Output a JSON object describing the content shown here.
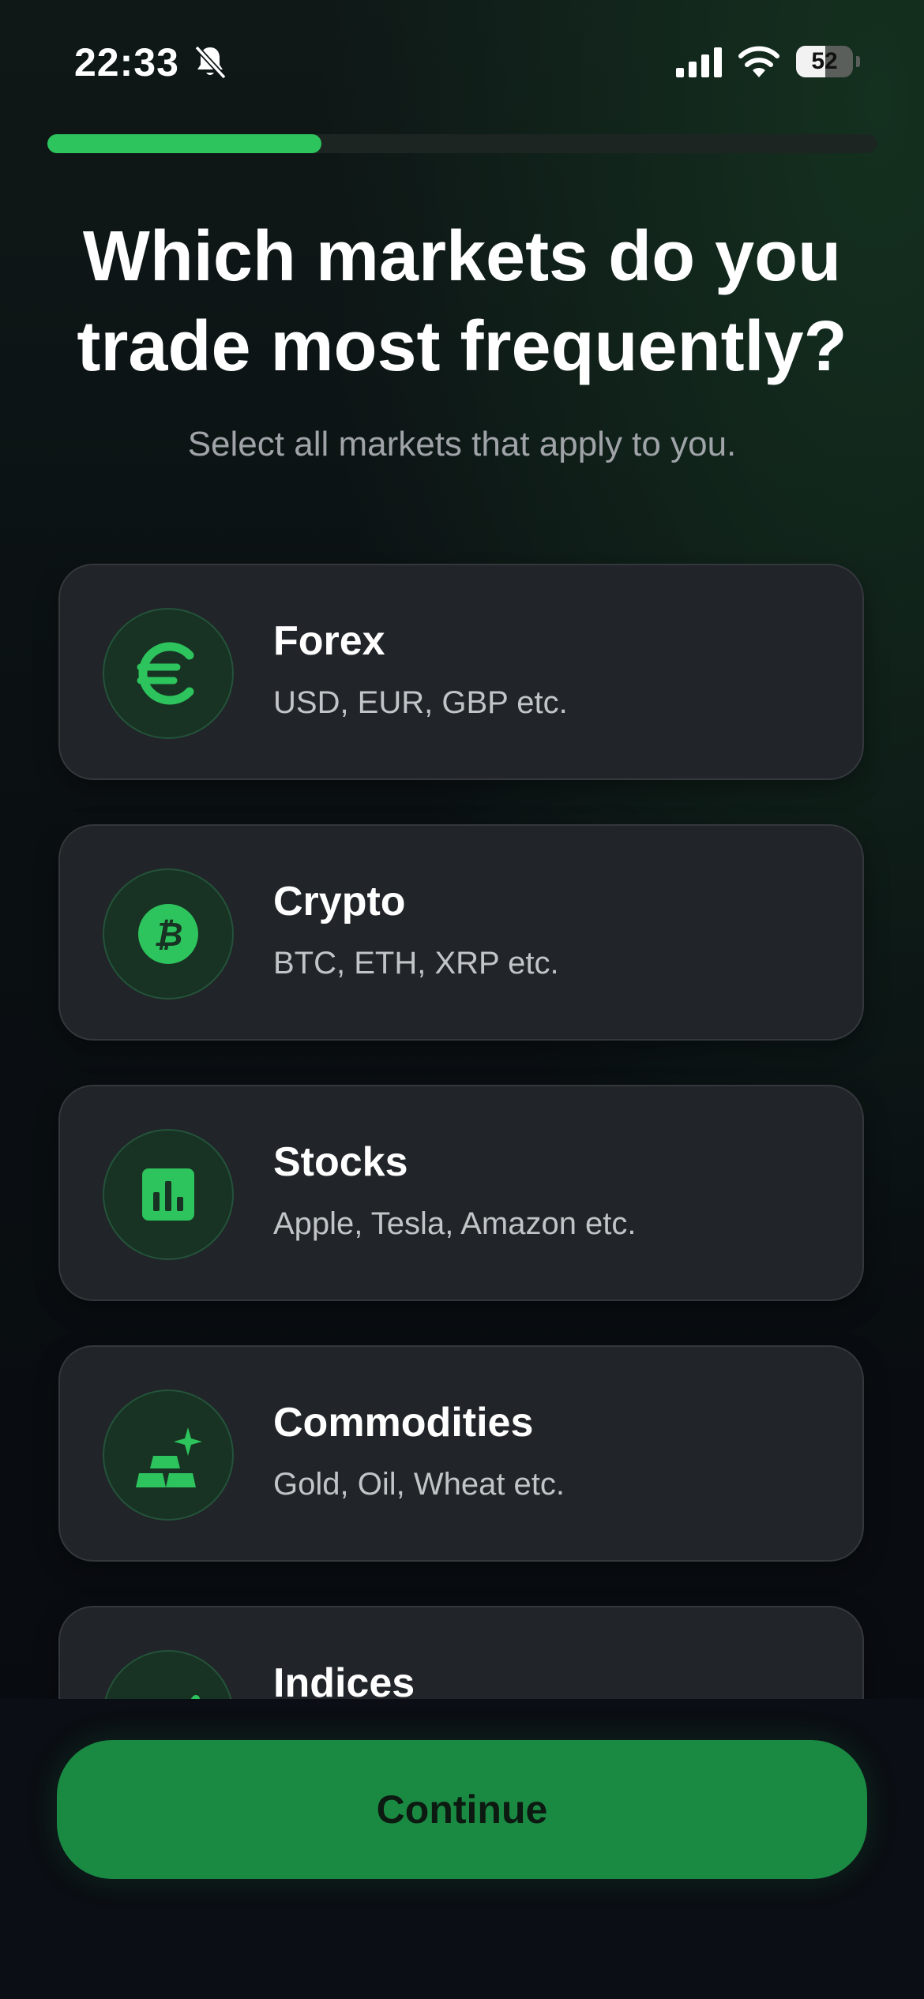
{
  "status_bar": {
    "time": "22:33",
    "battery_level": "52",
    "battery_fraction": 0.52
  },
  "progress": {
    "fraction": 0.33,
    "color": "#2dc35d"
  },
  "header": {
    "title": "Which markets do you trade most frequently?",
    "subtitle": "Select all markets that apply to you."
  },
  "markets": [
    {
      "title": "Forex",
      "subtitle": "USD, EUR, GBP etc.",
      "icon": "euro-icon"
    },
    {
      "title": "Crypto",
      "subtitle": "BTC, ETH, XRP etc.",
      "icon": "bitcoin-icon"
    },
    {
      "title": "Stocks",
      "subtitle": "Apple, Tesla, Amazon etc.",
      "icon": "bar-chart-icon"
    },
    {
      "title": "Commodities",
      "subtitle": "Gold, Oil, Wheat etc.",
      "icon": "gold-bars-icon"
    },
    {
      "title": "Indices",
      "subtitle": "",
      "icon": "index-chart-icon"
    }
  ],
  "continue_button": {
    "label": "Continue"
  },
  "colors": {
    "accent": "#2dc35d",
    "button": "#1a8a43",
    "card": "#212428"
  }
}
